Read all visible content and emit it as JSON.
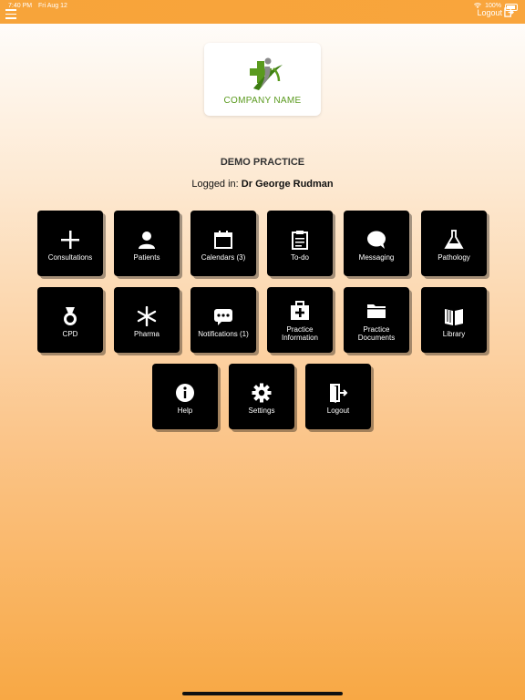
{
  "status_bar": {
    "time": "7:40 PM",
    "date": "Fri Aug 12",
    "battery": "100%"
  },
  "header": {
    "logout_label": "Logout"
  },
  "logo": {
    "company_name": "COMPANY NAME",
    "color": "#5a9a1e"
  },
  "practice_name": "DEMO PRACTICE",
  "login": {
    "prefix": "Logged in:",
    "user": "Dr George Rudman"
  },
  "tiles": [
    {
      "label": "Consultations",
      "icon": "plus-icon"
    },
    {
      "label": "Patients",
      "icon": "person-icon"
    },
    {
      "label": "Calendars (3)",
      "icon": "calendar-icon"
    },
    {
      "label": "To-do",
      "icon": "clipboard-icon"
    },
    {
      "label": "Messaging",
      "icon": "chat-bubble-icon"
    },
    {
      "label": "Pathology",
      "icon": "flask-icon"
    },
    {
      "label": "CPD",
      "icon": "medal-icon"
    },
    {
      "label": "Pharma",
      "icon": "asterisk-icon"
    },
    {
      "label": "Notifications (1)",
      "icon": "notification-bubble-icon"
    },
    {
      "label": "Practice\nInformation",
      "icon": "first-aid-kit-icon"
    },
    {
      "label": "Practice\nDocuments",
      "icon": "folder-icon"
    },
    {
      "label": "Library",
      "icon": "book-icon"
    },
    {
      "label": "Help",
      "icon": "info-icon"
    },
    {
      "label": "Settings",
      "icon": "gear-icon"
    },
    {
      "label": "Logout",
      "icon": "logout-icon"
    }
  ],
  "colors": {
    "accent": "#f8a23a",
    "tile": "#000000",
    "tile_text": "#ffffff"
  }
}
